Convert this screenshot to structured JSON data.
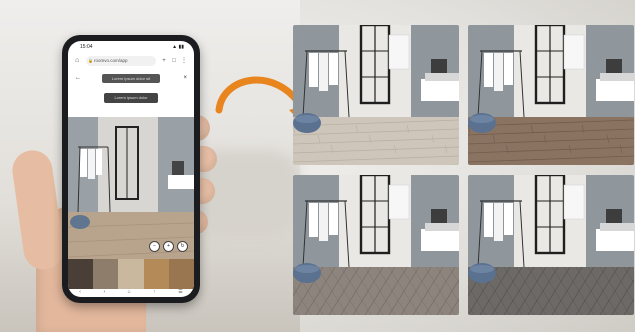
{
  "phone": {
    "status_time": "15:04",
    "status_right": "▲ ▮▮",
    "url": "roomvo.com/app",
    "pill_top": "Lorem ipsum dolor sit",
    "pill_mid": "Lorem ipsum dolor",
    "tools": [
      "−",
      "+",
      "↻"
    ],
    "nav": [
      "‹",
      "›",
      "⌂",
      "↑",
      "☰"
    ]
  },
  "floors": [
    {
      "name": "light-oak",
      "color": "#cfc6bb",
      "line": "#b9afa3"
    },
    {
      "name": "walnut",
      "color": "#8a7361",
      "line": "#715c4c"
    },
    {
      "name": "grey-herringbone",
      "color": "#8d857d",
      "line": "#736b64"
    },
    {
      "name": "charcoal",
      "color": "#6c6966",
      "line": "#55524f"
    }
  ],
  "swatches": [
    "#4a3f36",
    "#8e7d6a",
    "#c9b89d",
    "#b48a58",
    "#9a7650"
  ],
  "accent": "#e8851f"
}
